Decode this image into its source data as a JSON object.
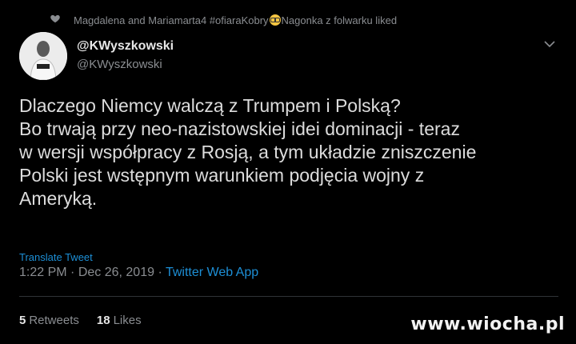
{
  "social_context": {
    "text_before": "Magdalena and Mariamarta4 #ofiaraKobry",
    "text_after": "Nagonka z folwarku liked"
  },
  "author": {
    "name": "@KWyszkowski",
    "handle": "@KWyszkowski"
  },
  "tweet": {
    "lines": [
      "Dlaczego Niemcy walczą z Trumpem i Polską?",
      "Bo trwają przy neo-nazistowskiej idei dominacji - teraz",
      "w wersji współpracy z Rosją, a tym układzie zniszczenie",
      "Polski jest wstępnym warunkiem podjęcia wojny z",
      "Ameryką."
    ]
  },
  "translate_label": "Translate Tweet",
  "meta": {
    "time": "1:22 PM",
    "separator": " · ",
    "date": "Dec 26, 2019",
    "app": "Twitter Web App"
  },
  "stats": {
    "retweets_count": "5",
    "retweets_label": "Retweets",
    "likes_count": "18",
    "likes_label": "Likes"
  },
  "watermark": "www.wiocha.pl",
  "colors": {
    "background": "#000000",
    "link": "#1d8fd6",
    "muted": "#8a8d91"
  }
}
